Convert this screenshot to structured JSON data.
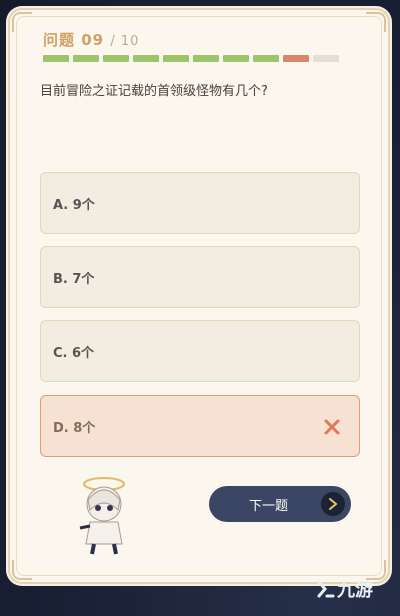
{
  "header": {
    "question_label": "问题",
    "current": "09",
    "total": "/ 10"
  },
  "progress": {
    "segments": [
      {
        "state": "correct",
        "color": "#9dc46a"
      },
      {
        "state": "correct",
        "color": "#9dc46a"
      },
      {
        "state": "correct",
        "color": "#9dc46a"
      },
      {
        "state": "correct",
        "color": "#9dc46a"
      },
      {
        "state": "correct",
        "color": "#9dc46a"
      },
      {
        "state": "correct",
        "color": "#9dc46a"
      },
      {
        "state": "correct",
        "color": "#9dc46a"
      },
      {
        "state": "correct",
        "color": "#9dc46a"
      },
      {
        "state": "wrong",
        "color": "#d9876a"
      },
      {
        "state": "pending",
        "color": "#e6ded2"
      }
    ]
  },
  "question": "目前冒险之证记载的首领级怪物有几个?",
  "options": [
    {
      "label": "A. 9个",
      "state": "normal"
    },
    {
      "label": "B. 7个",
      "state": "normal"
    },
    {
      "label": "C. 6个",
      "state": "normal"
    },
    {
      "label": "D. 8个",
      "state": "wrong"
    }
  ],
  "next_button": {
    "label": "下一题"
  },
  "watermark": {
    "text": "九游"
  },
  "colors": {
    "accent": "#d2a063",
    "correct": "#9dc46a",
    "wrong": "#d9876a",
    "button": "#3b4564"
  }
}
